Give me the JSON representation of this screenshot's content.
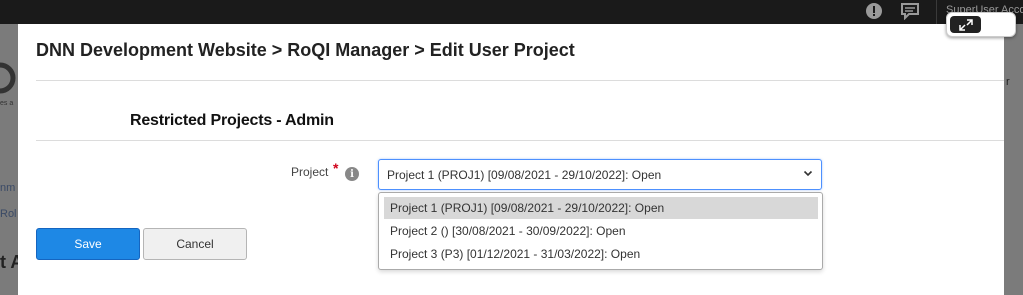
{
  "background": {
    "user_label": "SuperUser Acco",
    "side_text_left": [
      "nm",
      "Rol",
      "t A"
    ],
    "side_text_logo": "es a",
    "side_text_right": "r"
  },
  "modal": {
    "breadcrumb": "DNN Development Website > RoQI Manager > Edit User Project",
    "section_heading": "Restricted Projects - Admin",
    "project_field": {
      "label": "Project",
      "required_mark": "*",
      "info_glyph": "i",
      "selected_value": "Project 1 (PROJ1) [09/08/2021 - 29/10/2022]: Open",
      "options": [
        "Project 1 (PROJ1) [09/08/2021 - 29/10/2022]: Open",
        "Project 2 () [30/08/2021 - 30/09/2022]: Open",
        "Project 3 (P3) [01/12/2021 - 31/03/2022]: Open"
      ],
      "highlighted_option_index": 0
    },
    "buttons": {
      "save": "Save",
      "cancel": "Cancel"
    }
  },
  "icons": {
    "topbar": [
      "alert-icon",
      "chat-icon"
    ],
    "expand": "expand-icon",
    "chevron": "chevron-down-icon",
    "info": "info-icon"
  },
  "colors": {
    "primary_button": "#1e88e5",
    "required": "#d0021b",
    "focus_border": "#4d90fe"
  }
}
